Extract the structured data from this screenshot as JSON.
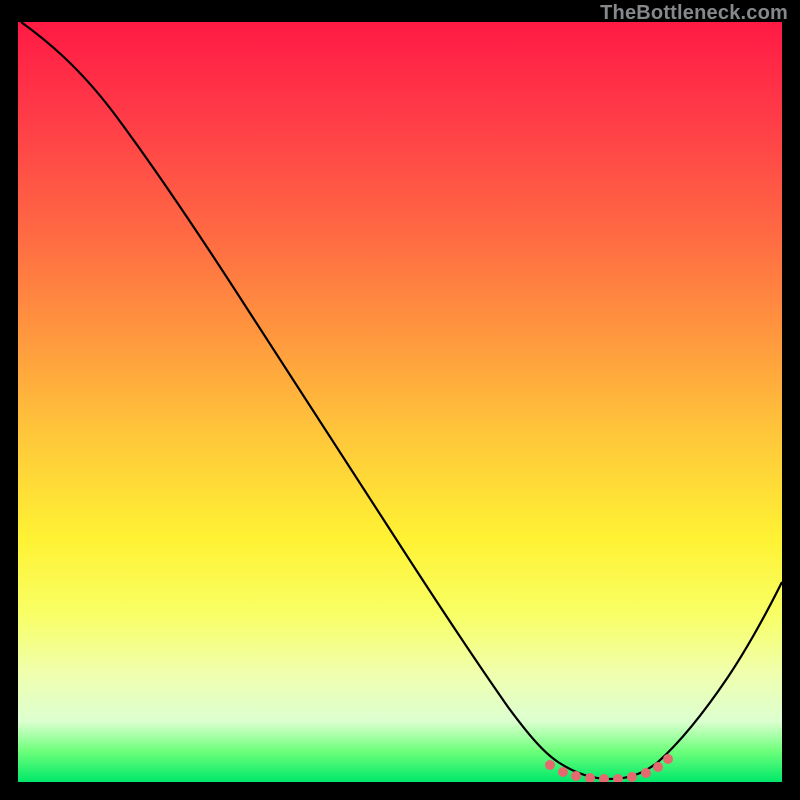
{
  "watermark": "TheBottleneck.com",
  "colors": {
    "curve": "#000000",
    "dots": "#e46a6f"
  },
  "chart_data": {
    "type": "line",
    "title": "",
    "xlabel": "",
    "ylabel": "",
    "xlim": [
      0,
      100
    ],
    "ylim": [
      0,
      100
    ],
    "grid": false,
    "legend": false,
    "series": [
      {
        "name": "main-curve",
        "x": [
          0,
          4,
          10,
          18,
          26,
          34,
          42,
          50,
          58,
          64,
          67,
          70,
          73,
          76,
          79,
          82,
          85,
          88,
          92,
          96,
          100
        ],
        "y": [
          100,
          99,
          96,
          90,
          81,
          71,
          61,
          51,
          40,
          30,
          22,
          14,
          8,
          4,
          2,
          2,
          4,
          8,
          14,
          21,
          28
        ]
      },
      {
        "name": "optimum-dots",
        "x": [
          70,
          71.5,
          73,
          75,
          77,
          79,
          81,
          83,
          84.5,
          85.5
        ],
        "y": [
          5,
          4,
          3,
          2.3,
          2,
          2,
          2.3,
          3,
          4,
          5
        ]
      }
    ]
  }
}
